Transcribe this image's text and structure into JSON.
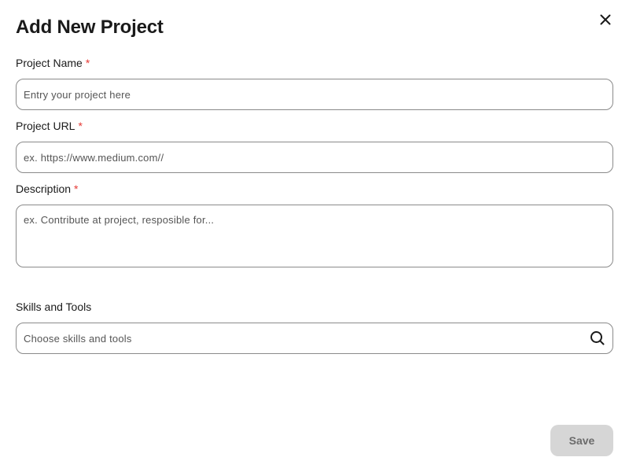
{
  "dialog": {
    "title": "Add New Project",
    "close_icon": "close-icon"
  },
  "fields": {
    "project_name": {
      "label": "Project Name",
      "required_mark": "*",
      "placeholder": "Entry your project here",
      "value": ""
    },
    "project_url": {
      "label": "Project URL",
      "required_mark": "*",
      "placeholder": "ex. https://www.medium.com//",
      "value": ""
    },
    "description": {
      "label": "Description",
      "required_mark": "*",
      "placeholder": "ex. Contribute at project, resposible for...",
      "value": ""
    },
    "skills": {
      "label": "Skills and Tools",
      "placeholder": "Choose skills and tools",
      "value": "",
      "icon": "search-icon"
    }
  },
  "actions": {
    "save_label": "Save"
  },
  "colors": {
    "required": "#e53935",
    "border": "#8a8a8a",
    "save_bg_disabled": "#d6d6d6",
    "save_text_disabled": "#6b6b6b"
  }
}
